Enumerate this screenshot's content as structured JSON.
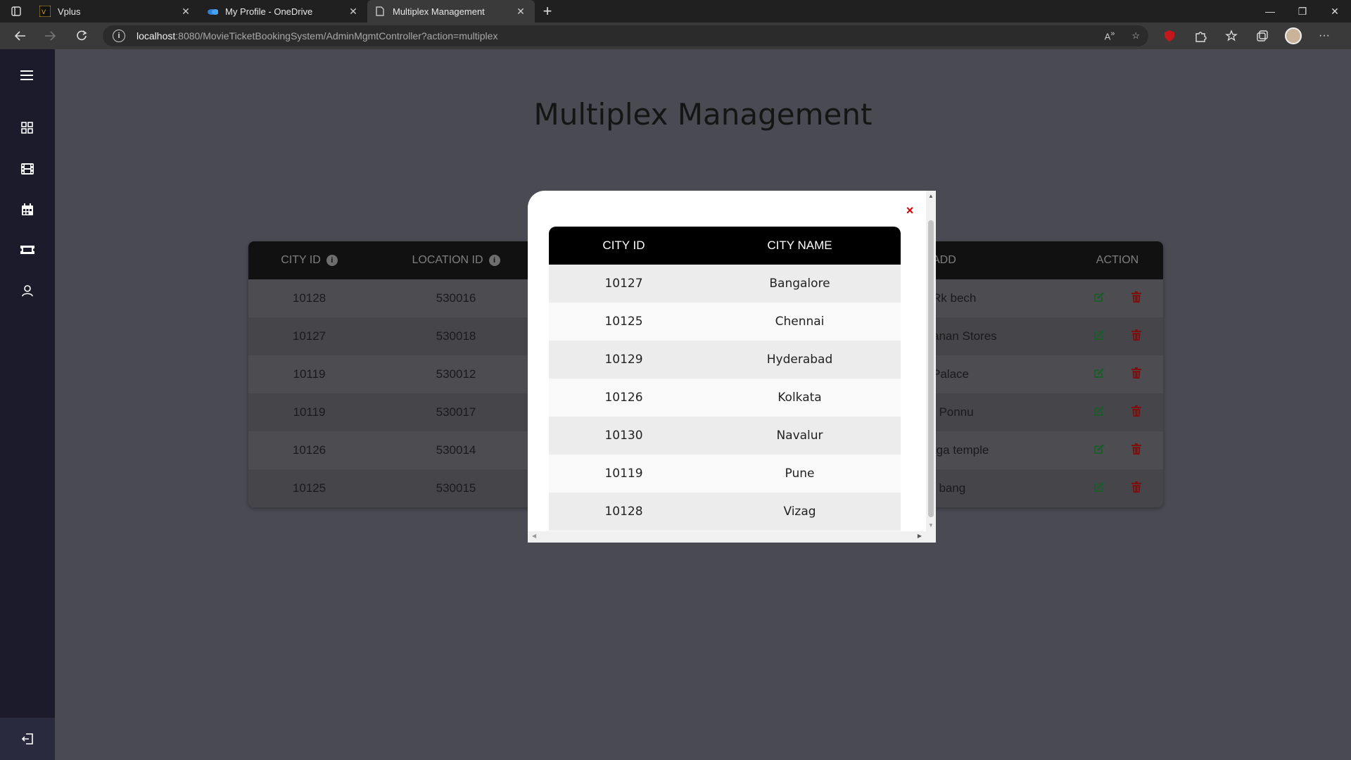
{
  "browser": {
    "tabs": [
      {
        "title": "Vplus",
        "icon": "vplus-icon"
      },
      {
        "title": "My Profile - OneDrive",
        "icon": "onedrive-icon"
      },
      {
        "title": "Multiplex Management",
        "icon": "page-icon",
        "active": true
      }
    ],
    "url_host": "localhost",
    "url_rest": ":8080/MovieTicketBookingSystem/AdminMgmtController?action=multiplex"
  },
  "page": {
    "title": "Multiplex Management"
  },
  "multiplex_table": {
    "headers": {
      "city_id": "CITY ID",
      "location_id": "LOCATION ID",
      "address": "ADD",
      "action": "ACTION"
    },
    "rows": [
      {
        "city_id": "10128",
        "location_id": "530016",
        "address": "Rk bech"
      },
      {
        "city_id": "10127",
        "location_id": "530018",
        "address": "anan Stores"
      },
      {
        "city_id": "10119",
        "location_id": "530012",
        "address": "Palace"
      },
      {
        "city_id": "10119",
        "location_id": "530017",
        "address": ". Ponnu"
      },
      {
        "city_id": "10126",
        "location_id": "530014",
        "address": "rga temple"
      },
      {
        "city_id": "10125",
        "location_id": "530015",
        "address": ", bang"
      }
    ]
  },
  "city_modal": {
    "close_label": "×",
    "headers": {
      "city_id": "CITY ID",
      "city_name": "CITY NAME"
    },
    "rows": [
      {
        "city_id": "10127",
        "city_name": "Bangalore"
      },
      {
        "city_id": "10125",
        "city_name": "Chennai"
      },
      {
        "city_id": "10129",
        "city_name": "Hyderabad"
      },
      {
        "city_id": "10126",
        "city_name": "Kolkata"
      },
      {
        "city_id": "10130",
        "city_name": "Navalur"
      },
      {
        "city_id": "10119",
        "city_name": "Pune"
      },
      {
        "city_id": "10128",
        "city_name": "Vizag"
      }
    ]
  },
  "colors": {
    "sidebar": "#1b1b2b",
    "page_bg": "#494a52",
    "edit_icon": "#1e5b2b",
    "delete_icon": "#7a1010",
    "close_icon": "#dd0000"
  }
}
